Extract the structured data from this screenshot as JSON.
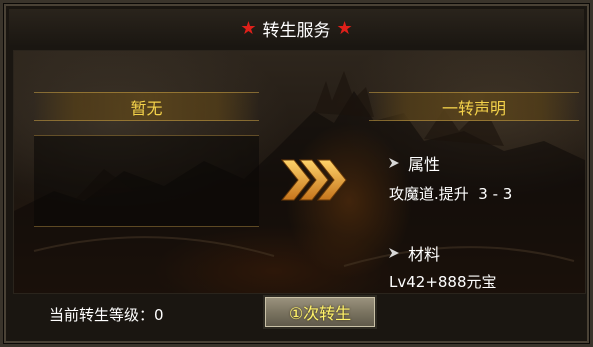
{
  "title": {
    "text": "转生服务",
    "star_left": "★",
    "star_right": "★"
  },
  "current": {
    "label": "暂无"
  },
  "next": {
    "label": "一转声明"
  },
  "attributes": {
    "heading": "属性",
    "value": "攻魔道.提升  3 - 3"
  },
  "materials": {
    "heading": "材料",
    "value": "Lv42+888元宝"
  },
  "footer": {
    "level_label": "当前转生等级：0"
  },
  "action": {
    "label": "①次转生"
  },
  "icons": {
    "arrows": "triple-chevron-right-icon",
    "bullet": "triangle-bullet-icon"
  },
  "colors": {
    "title_star": "#e0201a",
    "plate_text": "#f4d24a",
    "arrows": "#e8a533",
    "button_text": "#fff36a"
  }
}
